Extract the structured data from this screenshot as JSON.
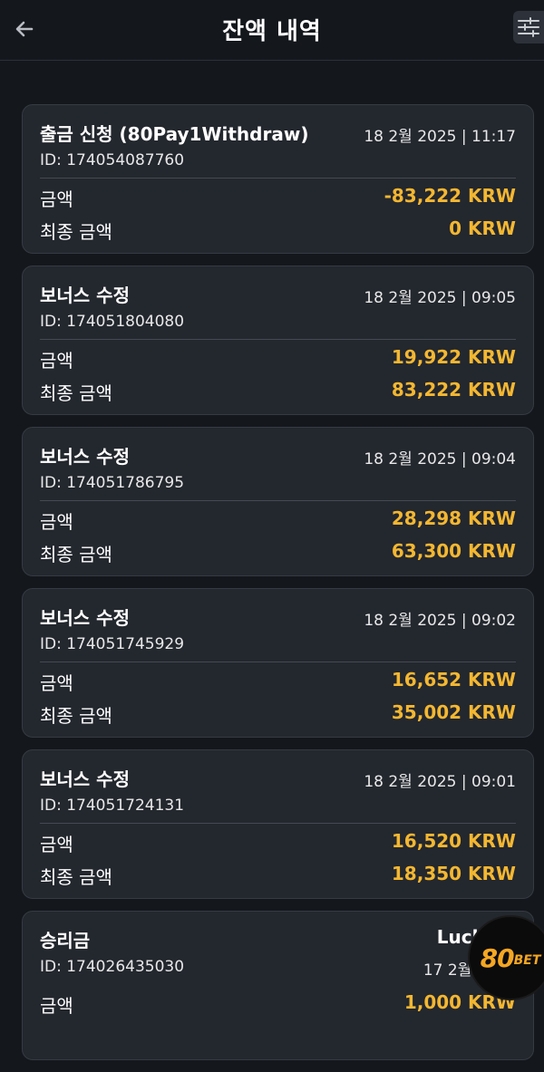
{
  "header": {
    "title": "잔액 내역",
    "back_icon": "arrow-left-icon",
    "filter_icon": "sliders-icon"
  },
  "labels": {
    "amount": "금액",
    "final_amount": "최종 금액"
  },
  "transactions": [
    {
      "title": "출금 신청 (80Pay1Withdraw)",
      "date": "18 2월 2025 | 11:17",
      "id": "ID: 174054087760",
      "amount": "-83,222 KRW",
      "final_amount": "0 KRW"
    },
    {
      "title": "보너스 수정",
      "date": "18 2월 2025 | 09:05",
      "id": "ID: 174051804080",
      "amount": "19,922 KRW",
      "final_amount": "83,222 KRW"
    },
    {
      "title": "보너스 수정",
      "date": "18 2월 2025 | 09:04",
      "id": "ID: 174051786795",
      "amount": "28,298 KRW",
      "final_amount": "63,300 KRW"
    },
    {
      "title": "보너스 수정",
      "date": "18 2월 2025 | 09:02",
      "id": "ID: 174051745929",
      "amount": "16,652 KRW",
      "final_amount": "35,002 KRW"
    },
    {
      "title": "보너스 수정",
      "date": "18 2월 2025 | 09:01",
      "id": "ID: 174051724131",
      "amount": "16,520 KRW",
      "final_amount": "18,350 KRW"
    },
    {
      "title": "승리금",
      "title_right": "LuckyW",
      "date": "17 2월 2025",
      "id": "ID: 174026435030",
      "amount": "1,000 KRW"
    }
  ],
  "logo": {
    "number": "80",
    "word": "BET"
  },
  "colors": {
    "background": "#14171c",
    "card": "#23272e",
    "accent": "#f4b731"
  }
}
